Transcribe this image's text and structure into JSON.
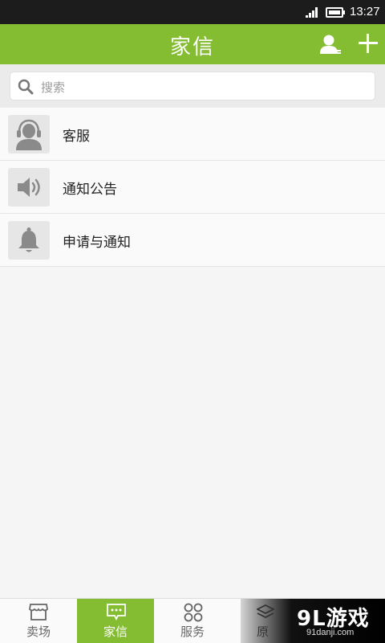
{
  "status_bar": {
    "time": "13:27"
  },
  "header": {
    "title": "家信"
  },
  "search": {
    "placeholder": "搜索"
  },
  "list": [
    {
      "label": "客服",
      "icon": "customer-service-icon"
    },
    {
      "label": "通知公告",
      "icon": "speaker-icon"
    },
    {
      "label": "申请与通知",
      "icon": "bell-icon"
    }
  ],
  "nav": [
    {
      "label": "卖场",
      "icon": "store-icon",
      "active": false
    },
    {
      "label": "家信",
      "icon": "message-icon",
      "active": true
    },
    {
      "label": "服务",
      "icon": "services-icon",
      "active": false
    },
    {
      "label": "原",
      "icon": "layers-icon",
      "active": false
    }
  ],
  "watermark": {
    "logo": "9L游戏",
    "url": "91danji.com"
  },
  "colors": {
    "accent": "#84bc32",
    "status_bar": "#1c1c1c"
  }
}
